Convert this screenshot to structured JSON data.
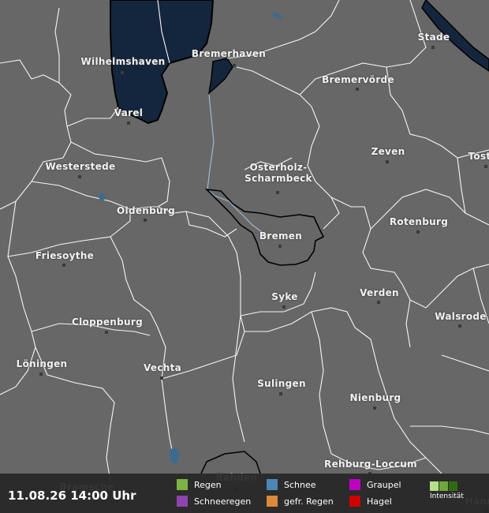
{
  "map": {
    "water_color": "#14263d",
    "land_color": "#676767",
    "cities": [
      {
        "name": "Stade"
      },
      {
        "name": "Wilhelmshaven"
      },
      {
        "name": "Bremerhaven"
      },
      {
        "name": "Bremervörde"
      },
      {
        "name": "Varel"
      },
      {
        "name": "Zeven"
      },
      {
        "name": "Tost"
      },
      {
        "name": "Westerstede"
      },
      {
        "name": "Osterholz-\nScharmbeck"
      },
      {
        "name": "Oldenburg"
      },
      {
        "name": "Rotenburg"
      },
      {
        "name": "Bremen"
      },
      {
        "name": "Friesoythe"
      },
      {
        "name": "Syke"
      },
      {
        "name": "Verden"
      },
      {
        "name": "Walsrode"
      },
      {
        "name": "Cloppenburg"
      },
      {
        "name": "Löningen"
      },
      {
        "name": "Vechta"
      },
      {
        "name": "Sulingen"
      },
      {
        "name": "Nienburg"
      },
      {
        "name": "Rehburg-Loccum"
      },
      {
        "name": "Rahden"
      },
      {
        "name": "Bramsche"
      },
      {
        "name": "Hann"
      }
    ]
  },
  "legend": {
    "timestamp": "11.08.26 14:00 Uhr",
    "items": [
      {
        "label": "Regen",
        "color": "#7cb342"
      },
      {
        "label": "Schnee",
        "color": "#4a86b8"
      },
      {
        "label": "Graupel",
        "color": "#c000c0"
      },
      {
        "label": "Schneeregen",
        "color": "#8e44ad"
      },
      {
        "label": "gefr. Regen",
        "color": "#d98a3a"
      },
      {
        "label": "Hagel",
        "color": "#d00000"
      }
    ],
    "intensity_label": "Intensität",
    "intensity_colors": [
      "#b5e08a",
      "#6fa83c",
      "#2f6b12"
    ]
  }
}
